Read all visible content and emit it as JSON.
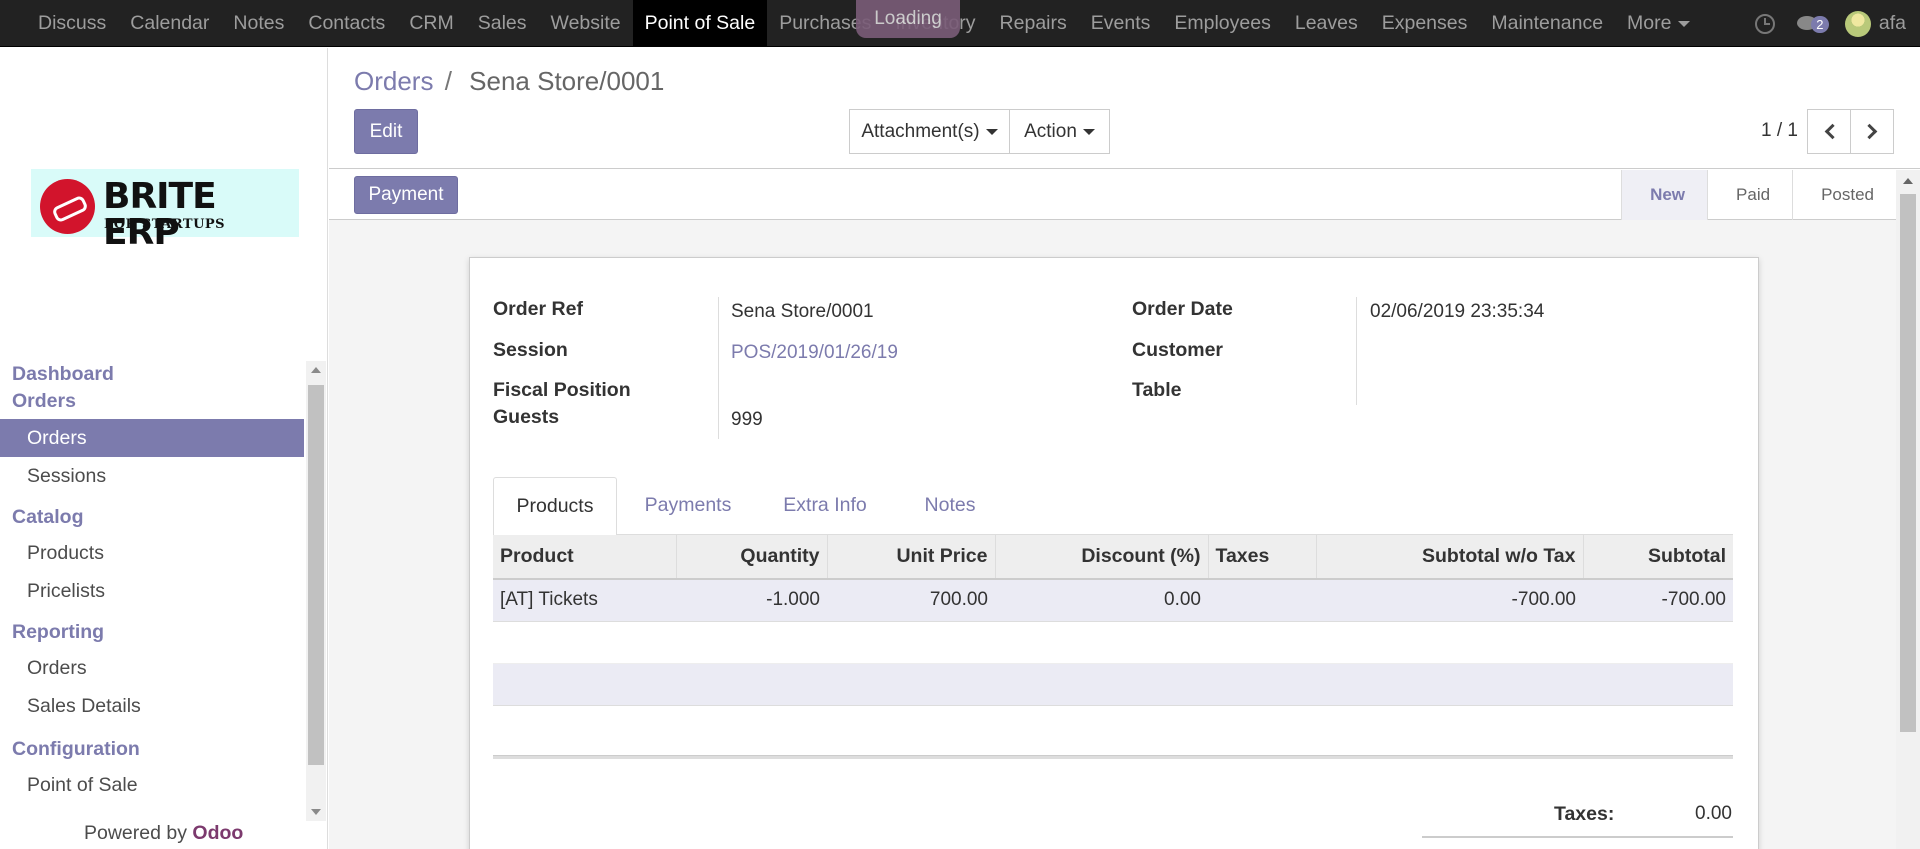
{
  "topnav": {
    "items": [
      "Discuss",
      "Calendar",
      "Notes",
      "Contacts",
      "CRM",
      "Sales",
      "Website",
      "Point of Sale",
      "Purchases",
      "Inventory",
      "Repairs",
      "Events",
      "Employees",
      "Leaves",
      "Expenses",
      "Maintenance",
      "More"
    ],
    "active": "Point of Sale",
    "loading": "Loading",
    "messages_count": "2",
    "user": "afa"
  },
  "logo": {
    "brand": "BRITE ERP",
    "tagline": "FOR STARTUPS"
  },
  "sidebar": {
    "sections": [
      {
        "head": "Dashboard",
        "items": []
      },
      {
        "head": "Orders",
        "items": [
          "Orders",
          "Sessions"
        ]
      },
      {
        "head": "Catalog",
        "items": [
          "Products",
          "Pricelists"
        ]
      },
      {
        "head": "Reporting",
        "items": [
          "Orders",
          "Sales Details"
        ]
      },
      {
        "head": "Configuration",
        "items": [
          "Point of Sale"
        ]
      }
    ],
    "powered_prefix": "Powered by",
    "powered_brand": "Odoo"
  },
  "breadcrumb": {
    "parent": "Orders",
    "sep": "/",
    "current": "Sena Store/0001"
  },
  "buttons": {
    "edit": "Edit",
    "attachments": "Attachment(s)",
    "action": "Action",
    "payment": "Payment"
  },
  "pager": {
    "value": "1 / 1"
  },
  "stages": [
    "New",
    "Paid",
    "Posted"
  ],
  "current_stage": "New",
  "form": {
    "order_ref_label": "Order Ref",
    "order_ref": "Sena Store/0001",
    "session_label": "Session",
    "session": "POS/2019/01/26/19",
    "fiscal_label": "Fiscal Position",
    "guests_label": "Guests",
    "guests": "999",
    "order_date_label": "Order Date",
    "order_date": "02/06/2019 23:35:34",
    "customer_label": "Customer",
    "table_label": "Table"
  },
  "tabs": [
    "Products",
    "Payments",
    "Extra Info",
    "Notes"
  ],
  "table": {
    "headers": [
      "Product",
      "Quantity",
      "Unit Price",
      "Discount (%)",
      "Taxes",
      "Subtotal w/o Tax",
      "Subtotal"
    ],
    "rows": [
      [
        "[AT] Tickets",
        "-1.000",
        "700.00",
        "0.00",
        "",
        "-700.00",
        "-700.00"
      ]
    ]
  },
  "totals": {
    "taxes_label": "Taxes:",
    "taxes": "0.00"
  },
  "colors": {
    "primary": "#7c7bad",
    "navbar": "#222222",
    "powered_brand": "#7c3a6e"
  }
}
